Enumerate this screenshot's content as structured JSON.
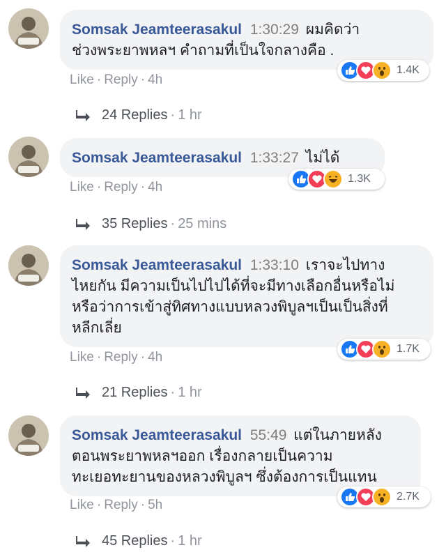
{
  "colors": {
    "author": "#385898",
    "timestamp": "#7f7f7f",
    "bubble_bg": "#f2f3f5",
    "meta": "#90949c",
    "like_blue": "#1877f2",
    "love_red": "#f33e58",
    "emoji_yellow": "#f7b125"
  },
  "comments": [
    {
      "author": "Somsak Jeamteerasakul",
      "timestamp": "1:30:29",
      "text_lines": [
        "ผมคิดว่า",
        "ช่วงพระยาพหลฯ คำถามที่เป็นใจกลางคือ ."
      ],
      "reactions": [
        "like-icon",
        "love-icon",
        "wow-icon"
      ],
      "reaction_count": "1.4K",
      "actions": {
        "like": "Like",
        "reply": "Reply",
        "age": "4h"
      },
      "replies": {
        "count": "24 Replies",
        "age": "1 hr"
      }
    },
    {
      "author": "Somsak Jeamteerasakul",
      "timestamp": "1:33:27",
      "text_lines": [
        "ไม่ได้"
      ],
      "reactions": [
        "like-icon",
        "love-icon",
        "haha-icon"
      ],
      "reaction_count": "1.3K",
      "actions": {
        "like": "Like",
        "reply": "Reply",
        "age": "4h"
      },
      "replies": {
        "count": "35 Replies",
        "age": "25 mins"
      }
    },
    {
      "author": "Somsak Jeamteerasakul",
      "timestamp": "1:33:10",
      "text_lines": [
        "เราจะไปทาง",
        "ไหยกัน มีความเป็นไปไปได้ที่จะมีทางเลือกอื่นหรือไม่",
        "หรือว่าการเข้าสู่ทิศทางแบบหลวงพิบูลฯเป็นเป็นสิ่งที่",
        "หลีกเลี่ย"
      ],
      "reactions": [
        "like-icon",
        "love-icon",
        "wow-icon"
      ],
      "reaction_count": "1.7K",
      "actions": {
        "like": "Like",
        "reply": "Reply",
        "age": "4h"
      },
      "replies": {
        "count": "21 Replies",
        "age": "1 hr"
      }
    },
    {
      "author": "Somsak Jeamteerasakul",
      "timestamp": "55:49",
      "text_lines": [
        "แต่ในภายหลัง",
        "ตอนพระยาพหลฯออก เรื่องกลายเป็นความ",
        "ทะเยอทะยานของหลวงพิบูลฯ ซึ่งต้องการเป็นแทน"
      ],
      "reactions": [
        "like-icon",
        "love-icon",
        "wow-icon"
      ],
      "reaction_count": "2.7K",
      "actions": {
        "like": "Like",
        "reply": "Reply",
        "age": "5h"
      },
      "replies": {
        "count": "45 Replies",
        "age": "1 hr"
      }
    }
  ]
}
